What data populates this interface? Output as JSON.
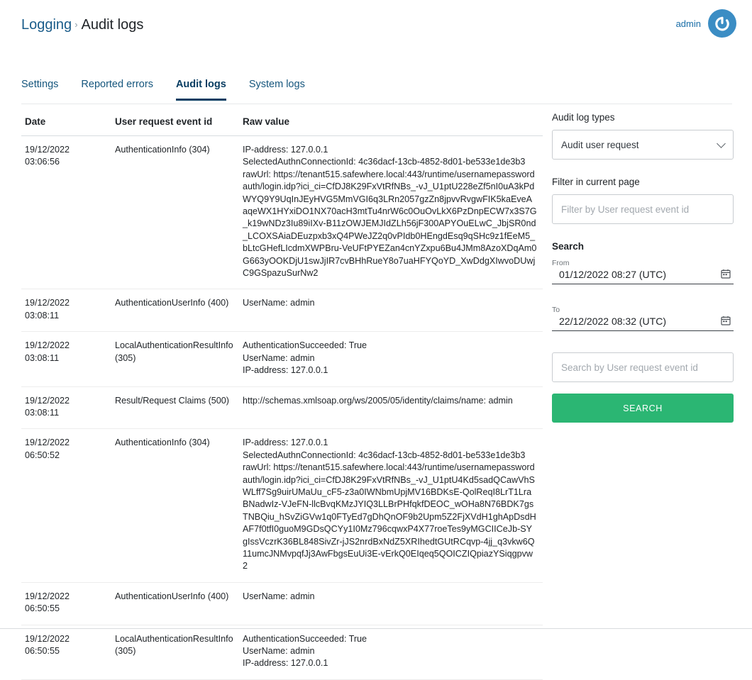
{
  "header": {
    "breadcrumb_parent": "Logging",
    "breadcrumb_separator": "›",
    "breadcrumb_current": "Audit logs",
    "user_name": "admin",
    "avatar_icon": "power-icon"
  },
  "tabs": [
    {
      "label": "Settings",
      "active": false
    },
    {
      "label": "Reported errors",
      "active": false
    },
    {
      "label": "Audit logs",
      "active": true
    },
    {
      "label": "System logs",
      "active": false
    }
  ],
  "table": {
    "columns": [
      "Date",
      "User request event id",
      "Raw value"
    ],
    "rows": [
      {
        "date_day": "19/12/2022",
        "date_time": "03:06:56",
        "event_id": "AuthenticationInfo (304)",
        "raw_lines": [
          "IP-address: 127.0.0.1",
          "SelectedAuthnConnectionId: 4c36dacf-13cb-4852-8d01-be533e1de3b3",
          "rawUrl: https://tenant515.safewhere.local:443/runtime/usernamepasswordauth/login.idp?ici_ci=CfDJ8K29FxVtRfNBs_-vJ_U1ptU228eZf5nI0uA3kPdWYQ9Y9UqInJEyHVG5MmVGI6q3LRn2057gzZn8jpvvRvgwFIK5kaEveAaqeWX1HYxiDO1NX70acH3mtTu4nrW6c0OuOvLkX6PzDnpECW7x3S7G_k19wNDz3Iu89iIXv-B11zOWJEMJIdZLh56jF300APYOuELwC_JbjSR0nd_LCOXSAiaDEuzpxb3xQ4PWeJZ2q0vPIdb0HEngdEsq9qSHc9z1fEeM5_bLtcGHefLIcdmXWPBru-VeUFtPYEZan4cnYZxpu6Bu4JMm8AzoXDqAm0G663yOOKDjU1swJjIR7cvBHhRueY8o7uaHFYQoYD_XwDdgXIwvoDUwjC9GSpazuSurNw2"
        ]
      },
      {
        "date_day": "19/12/2022",
        "date_time": "03:08:11",
        "event_id": "AuthenticationUserInfo (400)",
        "raw_lines": [
          "UserName: admin"
        ]
      },
      {
        "date_day": "19/12/2022",
        "date_time": "03:08:11",
        "event_id": "LocalAuthenticationResultInfo (305)",
        "raw_lines": [
          "AuthenticationSucceeded: True",
          "UserName: admin",
          "IP-address: 127.0.0.1"
        ]
      },
      {
        "date_day": "19/12/2022",
        "date_time": "03:08:11",
        "event_id": "Result/Request Claims (500)",
        "raw_lines": [
          "http://schemas.xmlsoap.org/ws/2005/05/identity/claims/name: admin"
        ]
      },
      {
        "date_day": "19/12/2022",
        "date_time": "06:50:52",
        "event_id": "AuthenticationInfo (304)",
        "raw_lines": [
          "IP-address: 127.0.0.1",
          "SelectedAuthnConnectionId: 4c36dacf-13cb-4852-8d01-be533e1de3b3",
          "rawUrl: https://tenant515.safewhere.local:443/runtime/usernamepasswordauth/login.idp?ici_ci=CfDJ8K29FxVtRfNBs_-vJ_U1ptU4Kd5sadQCawVhSWLff7Sg9uirUMaUu_cF5-z3a0IWNbmUpjMV16BDKsE-QolReqI8LrT1LraBNadwIz-VJeFN-llcBvqKMzJYIQ3LLBrPHfqkfDEOC_wOHa8N76BDK7gsTNBQiu_hSvZiGVw1q0FTyEd7gDhQnOF9b2Upm5Z2FjXVdH1ghApDsdHAF7f0tfI0guoM9GDsQCYy1I0Mz796cqwxP4X77roeTes9yMGCIICeJb-SYgIssVczrK36BL848SivZr-jJS2nrdBxNdZ5XRIhedtGUtRCqvp-4jj_q3vkw6Q11umcJNMvpqfJj3AwFbgsEuUi3E-vErkQ0EIqeq5QOICZIQpiazYSiqgpvw2"
        ]
      },
      {
        "date_day": "19/12/2022",
        "date_time": "06:50:55",
        "event_id": "AuthenticationUserInfo (400)",
        "raw_lines": [
          "UserName: admin"
        ]
      },
      {
        "date_day": "19/12/2022",
        "date_time": "06:50:55",
        "event_id": "LocalAuthenticationResultInfo (305)",
        "raw_lines": [
          "AuthenticationSucceeded: True",
          "UserName: admin",
          "IP-address: 127.0.0.1"
        ]
      }
    ]
  },
  "panel": {
    "audit_log_types_label": "Audit log types",
    "audit_log_types_value": "Audit user request",
    "filter_label": "Filter in current page",
    "filter_placeholder": "Filter by User request event id",
    "search_title": "Search",
    "from_caption": "From",
    "from_value": "01/12/2022 08:27 (UTC)",
    "to_caption": "To",
    "to_value": "22/12/2022 08:32 (UTC)",
    "search_placeholder": "Search by User request event id",
    "search_button": "SEARCH",
    "search_button_color": "#2bb673"
  }
}
